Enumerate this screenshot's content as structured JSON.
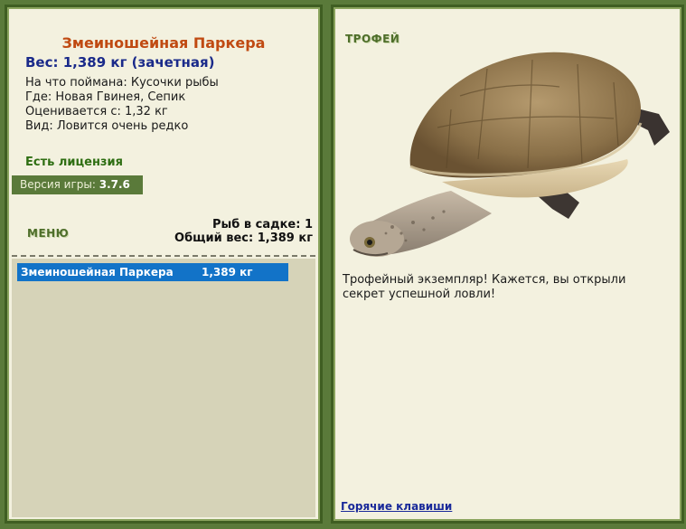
{
  "fish": {
    "title": "Змеиношейная Паркера",
    "weight_line": "Вес: 1,389 кг (зачетная)",
    "bait": "На что поймана: Кусочки рыбы",
    "where": "Где: Новая Гвинея, Сепик",
    "price": "Оценивается с: 1,32 кг",
    "kind": "Вид: Ловится очень редко"
  },
  "license": "Есть лицензия",
  "version": {
    "label": "Версия игры:",
    "value": "3.7.6"
  },
  "menu_label": "МЕНЮ",
  "keepnet": {
    "count_line": "Рыб в садке: 1",
    "total_line": "Общий вес: 1,389 кг"
  },
  "catch_list": [
    {
      "name": "Змеиношейная Паркера",
      "weight": "1,389 кг"
    }
  ],
  "trophy": {
    "label": "ТРОФЕЙ",
    "text": "Трофейный экземпляр! Кажется, вы открыли секрет успешной ловли!",
    "image": "turtle-image"
  },
  "hotkeys": "Горячие клавиши",
  "colors": {
    "frame": "#5a7a3a",
    "panel": "#f3f1df",
    "title": "#c04a12",
    "weight": "#1a2a8a",
    "selected_row": "#1273c8"
  }
}
